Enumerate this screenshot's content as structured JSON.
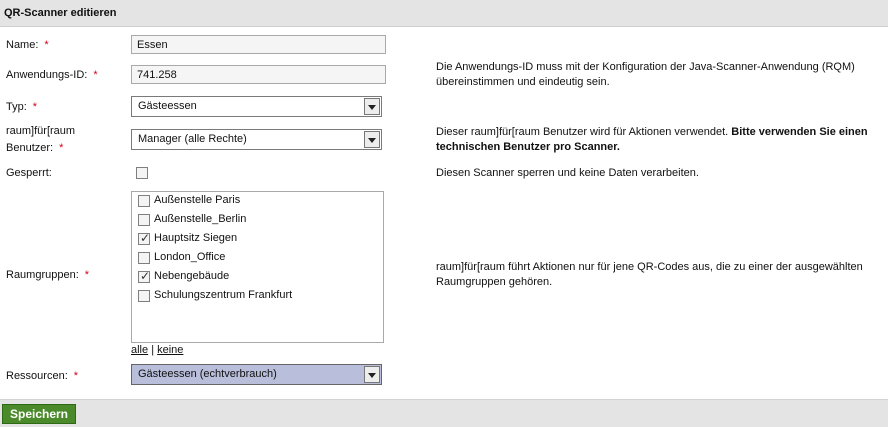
{
  "header": {
    "title": "QR-Scanner editieren"
  },
  "form": {
    "required_marker": "*",
    "name": {
      "label": "Name:",
      "value": "Essen"
    },
    "app_id": {
      "label": "Anwendungs-ID:",
      "value": "741.258",
      "hint": "Die Anwendungs-ID muss mit der Konfiguration der Java-Scanner-Anwendung (RQM) übereinstimmen und eindeutig sein."
    },
    "type": {
      "label": "Typ:",
      "value": "Gästeessen"
    },
    "user": {
      "label_line1": "raum]für[raum",
      "label_line2": "Benutzer:",
      "value": "Manager (alle Rechte)",
      "hint_normal": "Dieser raum]für[raum Benutzer wird für Aktionen verwendet. ",
      "hint_bold": "Bitte verwenden Sie einen technischen Benutzer pro Scanner."
    },
    "locked": {
      "label": "Gesperrt:",
      "checked": false,
      "hint": "Diesen Scanner sperren und keine Daten verarbeiten."
    },
    "room_groups": {
      "label": "Raumgruppen:",
      "items": [
        {
          "label": "Außenstelle Paris",
          "checked": false
        },
        {
          "label": "Außenstelle_Berlin",
          "checked": false
        },
        {
          "label": "Hauptsitz Siegen",
          "checked": true
        },
        {
          "label": "London_Office",
          "checked": false
        },
        {
          "label": "Nebengebäude",
          "checked": true
        },
        {
          "label": "Schulungszentrum Frankfurt",
          "checked": false
        }
      ],
      "select_all": "alle",
      "separator": "|",
      "select_none": "keine",
      "hint": "raum]für[raum führt Aktionen nur für jene QR-Codes aus, die zu einer der ausgewählten Raumgruppen gehören."
    },
    "resources": {
      "label": "Ressourcen:",
      "value": "Gästeessen (echtverbrauch)"
    }
  },
  "footer": {
    "save_label": "Speichern"
  },
  "colors": {
    "required": "#d0021b",
    "save_button": "#4a8a2a",
    "bar_background": "#e4e4e4",
    "selected_dropdown": "#b9bedb"
  }
}
